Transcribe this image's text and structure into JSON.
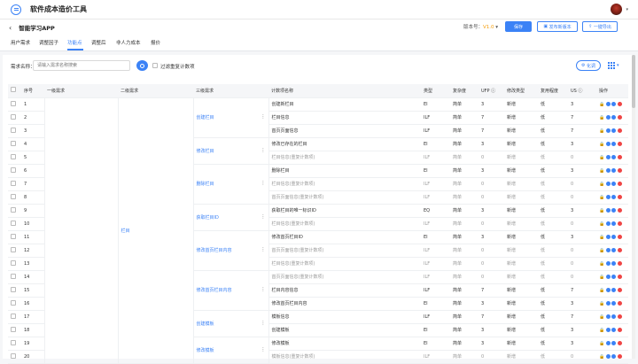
{
  "app": {
    "title": "软件成本造价工具"
  },
  "project": {
    "name": "智能学习APP",
    "version_label": "版本号：",
    "version": "V1.0",
    "btn_save": "保存",
    "btn_publish": "发布新版本",
    "btn_export": "一键导出"
  },
  "tabs": [
    "用户需求",
    "调整因子",
    "功能点",
    "调整后",
    "非人力成本",
    "报价"
  ],
  "active_tab": 2,
  "filter": {
    "label": "需求名称：",
    "placeholder": "请输入需求名称搜索",
    "checkbox_label": "过滤重复计数项",
    "column_btn": "化调"
  },
  "table": {
    "headers": [
      "",
      "序号",
      "一级需求",
      "二级需求",
      "三级需求",
      "计数项名称",
      "类型",
      "复杂度",
      "UFP",
      "修改类型",
      "复用程度",
      "US",
      "操作"
    ],
    "level1": "",
    "level2": "栏目",
    "level3": [
      {
        "label": "创建栏目",
        "span": 3
      },
      {
        "label": "修改栏目",
        "span": 2
      },
      {
        "label": "删除栏目",
        "span": 3
      },
      {
        "label": "获取栏目ID",
        "span": 2
      },
      {
        "label": "修改首页栏目内容",
        "span": 3
      },
      {
        "label": "修改首页栏目内容",
        "span": 3
      },
      {
        "label": "创建模板",
        "span": 2
      },
      {
        "label": "修改模板",
        "span": 2
      }
    ],
    "rows": [
      {
        "no": "1",
        "name": "创建新栏目",
        "type": "EI",
        "cx": "简单",
        "ufp": "3",
        "mod": "新增",
        "reuse": "低",
        "us": "3",
        "gray": false
      },
      {
        "no": "2",
        "name": "栏目信息",
        "type": "ILF",
        "cx": "简单",
        "ufp": "7",
        "mod": "新增",
        "reuse": "低",
        "us": "7",
        "gray": false
      },
      {
        "no": "3",
        "name": "首页页面信息",
        "type": "ILF",
        "cx": "简单",
        "ufp": "7",
        "mod": "新增",
        "reuse": "低",
        "us": "7",
        "gray": false
      },
      {
        "no": "4",
        "name": "修改已存在的栏目",
        "type": "EI",
        "cx": "简单",
        "ufp": "3",
        "mod": "新增",
        "reuse": "低",
        "us": "3",
        "gray": false
      },
      {
        "no": "5",
        "name": "栏目信息(重复计数项)",
        "type": "ILF",
        "cx": "简单",
        "ufp": "0",
        "mod": "新增",
        "reuse": "低",
        "us": "0",
        "gray": true
      },
      {
        "no": "6",
        "name": "删除栏目",
        "type": "EI",
        "cx": "简单",
        "ufp": "3",
        "mod": "新增",
        "reuse": "低",
        "us": "3",
        "gray": false
      },
      {
        "no": "7",
        "name": "栏目信息(重复计数项)",
        "type": "ILF",
        "cx": "简单",
        "ufp": "0",
        "mod": "新增",
        "reuse": "低",
        "us": "0",
        "gray": true
      },
      {
        "no": "8",
        "name": "首页页面信息(重复计数项)",
        "type": "ILF",
        "cx": "简单",
        "ufp": "0",
        "mod": "新增",
        "reuse": "低",
        "us": "0",
        "gray": true
      },
      {
        "no": "9",
        "name": "获取栏目的唯一标识ID",
        "type": "EQ",
        "cx": "简单",
        "ufp": "3",
        "mod": "新增",
        "reuse": "低",
        "us": "3",
        "gray": false
      },
      {
        "no": "10",
        "name": "栏目信息(重复计数项)",
        "type": "ILF",
        "cx": "简单",
        "ufp": "0",
        "mod": "新增",
        "reuse": "低",
        "us": "0",
        "gray": true
      },
      {
        "no": "11",
        "name": "修改首页栏目ID",
        "type": "EI",
        "cx": "简单",
        "ufp": "3",
        "mod": "新增",
        "reuse": "低",
        "us": "3",
        "gray": false
      },
      {
        "no": "12",
        "name": "首页页面信息(重复计数项)",
        "type": "ILF",
        "cx": "简单",
        "ufp": "0",
        "mod": "新增",
        "reuse": "低",
        "us": "0",
        "gray": true
      },
      {
        "no": "13",
        "name": "栏目信息(重复计数项)",
        "type": "ILF",
        "cx": "简单",
        "ufp": "0",
        "mod": "新增",
        "reuse": "低",
        "us": "0",
        "gray": true
      },
      {
        "no": "14",
        "name": "首页页面信息(重复计数项)",
        "type": "ILF",
        "cx": "简单",
        "ufp": "0",
        "mod": "新增",
        "reuse": "低",
        "us": "0",
        "gray": true
      },
      {
        "no": "15",
        "name": "栏目内容信息",
        "type": "ILF",
        "cx": "简单",
        "ufp": "7",
        "mod": "新增",
        "reuse": "低",
        "us": "7",
        "gray": false
      },
      {
        "no": "16",
        "name": "修改首页栏目内容",
        "type": "EI",
        "cx": "简单",
        "ufp": "3",
        "mod": "新增",
        "reuse": "低",
        "us": "3",
        "gray": false
      },
      {
        "no": "17",
        "name": "模板信息",
        "type": "ILF",
        "cx": "简单",
        "ufp": "7",
        "mod": "新增",
        "reuse": "低",
        "us": "7",
        "gray": false
      },
      {
        "no": "18",
        "name": "创建模板",
        "type": "EI",
        "cx": "简单",
        "ufp": "3",
        "mod": "新增",
        "reuse": "低",
        "us": "3",
        "gray": false
      },
      {
        "no": "19",
        "name": "修改模板",
        "type": "EI",
        "cx": "简单",
        "ufp": "3",
        "mod": "新增",
        "reuse": "低",
        "us": "3",
        "gray": false
      },
      {
        "no": "20",
        "name": "模板信息(重复计数项)",
        "type": "ILF",
        "cx": "简单",
        "ufp": "0",
        "mod": "新增",
        "reuse": "低",
        "us": "0",
        "gray": true
      }
    ],
    "action_icons": [
      "lock-icon",
      "copy-icon",
      "add-icon",
      "delete-icon"
    ],
    "action_colors": [
      "#3b82f6",
      "#3b82f6",
      "#ef4444"
    ]
  }
}
